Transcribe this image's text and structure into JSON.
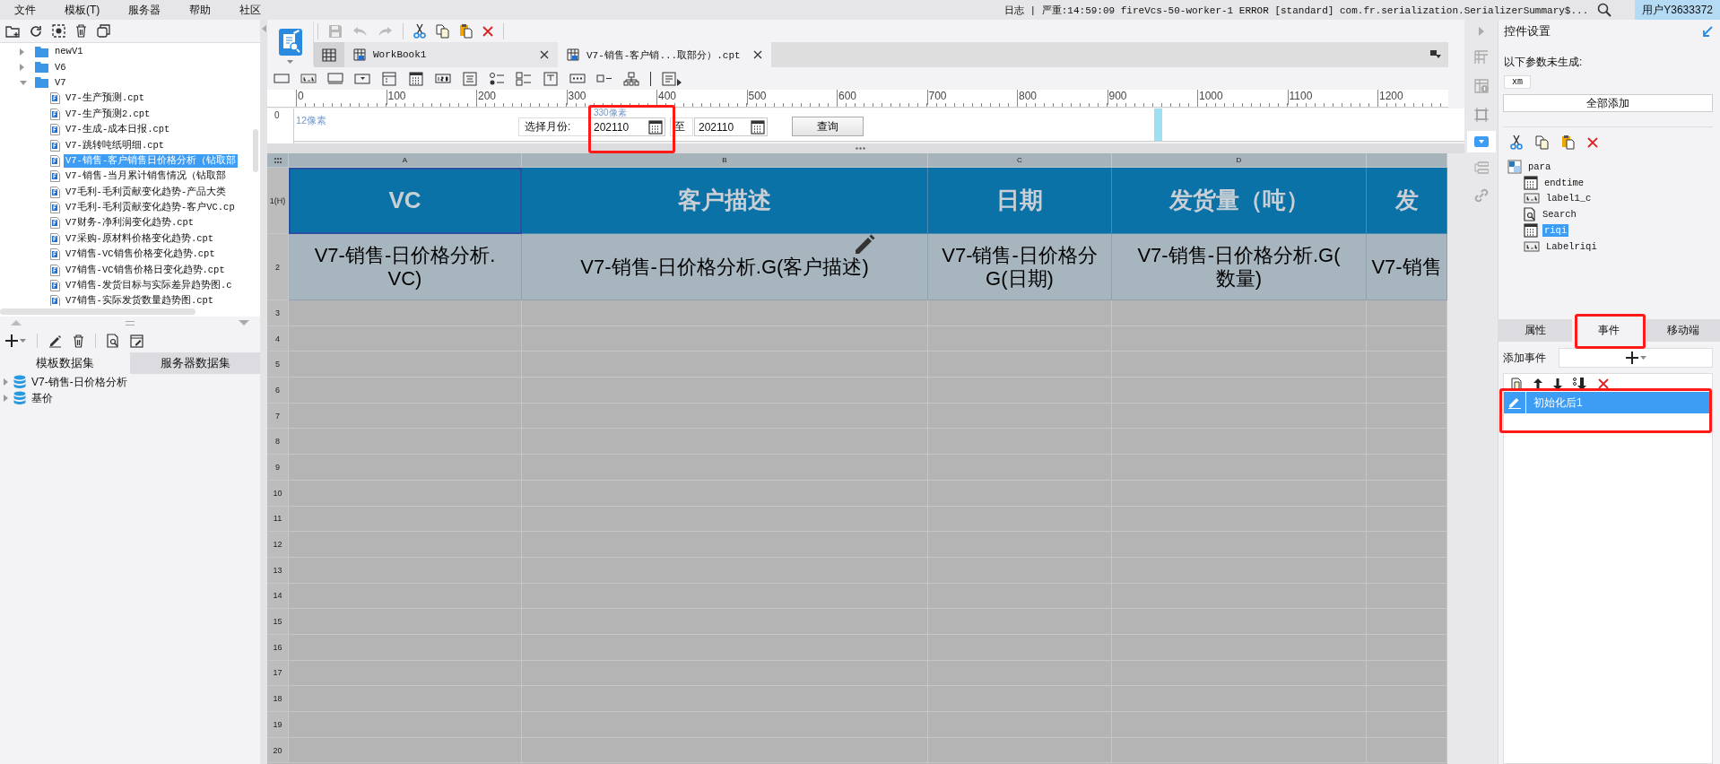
{
  "menu": [
    {
      "label": "文件"
    },
    {
      "label": "模板(T)"
    },
    {
      "label": "服务器"
    },
    {
      "label": "帮助"
    },
    {
      "label": "社区"
    }
  ],
  "log": "日志 | 严重:14:59:09 fireVcs-50-worker-1 ERROR [standard] com.fr.serialization.SerializerSummary$...",
  "user": "用户Y3633372",
  "file_tree": [
    {
      "label": "newV1",
      "kind": "folder",
      "expanded": false,
      "selected": false
    },
    {
      "label": "V6",
      "kind": "folder",
      "expanded": false,
      "selected": false
    },
    {
      "label": "V7",
      "kind": "folder",
      "expanded": true,
      "selected": false,
      "children": [
        {
          "label": "V7-生产预测.cpt",
          "kind": "file",
          "selected": false
        },
        {
          "label": "V7-生产预测2.cpt",
          "kind": "file",
          "selected": false
        },
        {
          "label": "V7-生成-成本日报.cpt",
          "kind": "file",
          "selected": false
        },
        {
          "label": "V7-跳转吨纸明细.cpt",
          "kind": "file",
          "selected": false
        },
        {
          "label": "V7-销售-客户销售日价格分析（钻取部",
          "kind": "file",
          "selected": true
        },
        {
          "label": "V7-销售-当月累计销售情况（钻取部",
          "kind": "file",
          "selected": false
        },
        {
          "label": "V7毛利-毛利贡献变化趋势-产品大类",
          "kind": "file",
          "selected": false
        },
        {
          "label": "V7毛利-毛利贡献变化趋势-客户VC.cp",
          "kind": "file",
          "selected": false
        },
        {
          "label": "V7财务-净利润变化趋势.cpt",
          "kind": "file",
          "selected": false
        },
        {
          "label": "V7采购-原材料价格变化趋势.cpt",
          "kind": "file",
          "selected": false
        },
        {
          "label": "V7销售-VC销售价格变化趋势.cpt",
          "kind": "file",
          "selected": false
        },
        {
          "label": "V7销售-VC销售价格日变化趋势.cpt",
          "kind": "file",
          "selected": false
        },
        {
          "label": "V7销售-发货目标与实际差异趋势图.c",
          "kind": "file",
          "selected": false
        },
        {
          "label": "V7销售-实际发货数量趋势图.cpt",
          "kind": "file",
          "selected": false
        }
      ]
    }
  ],
  "dataset_tabs": [
    {
      "label": "模板数据集",
      "selected": true
    },
    {
      "label": "服务器数据集",
      "selected": false
    }
  ],
  "datasets": [
    {
      "label": "V7-销售-日价格分析"
    },
    {
      "label": "基价"
    }
  ],
  "editor_tabs": [
    {
      "label": "WorkBook1",
      "selected": false
    },
    {
      "label": "V7-销售-客户销...取部分）.cpt",
      "selected": true
    }
  ],
  "ruler": {
    "vertical_label": "0",
    "labels": [
      "0",
      "100",
      "200",
      "300",
      "400",
      "500",
      "600",
      "700",
      "800",
      "900",
      "1000",
      "1100",
      "1200"
    ]
  },
  "param_pane": {
    "margin_hint": "12像素",
    "width_hint": "330像素",
    "month_label": "选择月份:",
    "start_value": "202110",
    "to_label": "至",
    "end_value": "202110",
    "query_button": "查询"
  },
  "sheet": {
    "columns": [
      "A",
      "B",
      "C",
      "D"
    ],
    "rows": [
      {
        "header": "1(H)",
        "kind": "title",
        "cells": [
          "VC",
          "客户描述",
          "日期",
          "发货量（吨）",
          "发"
        ]
      },
      {
        "header": "2",
        "kind": "data",
        "cells": [
          "V7-销售-日价格分析.\nVC)",
          "V7-销售-日价格分析.G(客户描述)",
          "V7-销售-日价格分\nG(日期)",
          "V7-销售-日价格分析.G(\n数量)",
          "V7-销售"
        ]
      }
    ],
    "empty_rows": [
      "3",
      "4",
      "5",
      "6",
      "7",
      "8",
      "9",
      "10",
      "11",
      "12",
      "13",
      "14",
      "15",
      "16",
      "17",
      "18",
      "19",
      "20"
    ]
  },
  "right_panel": {
    "title": "控件设置",
    "missing_label": "以下参数未生成:",
    "missing_params": [
      "xm"
    ],
    "add_all_button": "全部添加",
    "widget_tree": {
      "label": "para",
      "children": [
        {
          "label": "endtime",
          "kind": "date",
          "selected": false
        },
        {
          "label": "label1_c",
          "kind": "label",
          "selected": false
        },
        {
          "label": "Search",
          "kind": "search",
          "selected": false
        },
        {
          "label": "riqi",
          "kind": "date",
          "selected": true
        },
        {
          "label": "Labelriqi",
          "kind": "label",
          "selected": false
        }
      ]
    },
    "tabs": [
      {
        "label": "属性",
        "selected": false
      },
      {
        "label": "事件",
        "selected": true
      },
      {
        "label": "移动端",
        "selected": false
      }
    ],
    "add_event_label": "添加事件",
    "events": [
      {
        "label": "初始化后1",
        "selected": true
      }
    ]
  }
}
